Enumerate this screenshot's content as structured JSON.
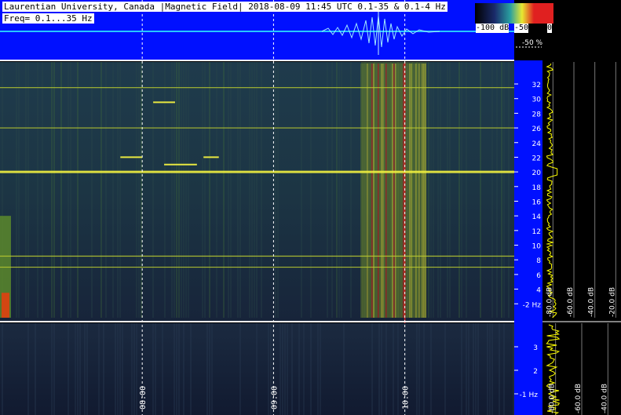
{
  "header": {
    "title": "Laurentian University, Canada |Magnetic Field| 2018-08-09 11:45 UTC 0.1-35 & 0.1-4 Hz",
    "freq_range": "Freq= 0.1...35 Hz"
  },
  "colorbar": {
    "labels": [
      "-100 dB",
      "-50",
      "0"
    ],
    "colors": [
      "#000000",
      "#0a2a90",
      "#2aa0a0",
      "#e8e830",
      "#e02020"
    ]
  },
  "percent_label": "-50 %",
  "chart_data": [
    {
      "type": "heatmap",
      "title": "",
      "ylabel": "Hz",
      "ylim": [
        0.1,
        35
      ],
      "yticks": [
        "-2 Hz",
        "4",
        "6",
        "8",
        "10",
        "12",
        "14",
        "16",
        "18",
        "20",
        "22",
        "24",
        "26",
        "28",
        "30",
        "32"
      ],
      "y_values": [
        2,
        4,
        6,
        8,
        10,
        12,
        14,
        16,
        18,
        20,
        22,
        24,
        26,
        28,
        30,
        32
      ],
      "persistent_lines_hz": [
        7.0,
        8.5,
        20.0,
        26.0,
        31.5
      ],
      "transient_lines": [
        {
          "hz": 22.0,
          "start": "07:50",
          "end": "08:00"
        },
        {
          "hz": 21.0,
          "start": "08:10",
          "end": "08:25"
        },
        {
          "hz": 22.0,
          "start": "08:28",
          "end": "08:35"
        },
        {
          "hz": 29.5,
          "start": "08:05",
          "end": "08:15"
        }
      ],
      "events": [
        {
          "start": "09:40",
          "end": "10:10",
          "peak": "10:00",
          "intensity_db": 0
        },
        {
          "start": "06:55",
          "end": "07:00",
          "intensity_db": -20
        }
      ]
    },
    {
      "type": "heatmap",
      "ylabel": "Hz",
      "ylim": [
        0.1,
        4
      ],
      "yticks": [
        "-1 Hz",
        "2",
        "3"
      ],
      "y_values": [
        1,
        2,
        3
      ]
    },
    {
      "type": "line",
      "title": "",
      "xlabel": "",
      "xticks": [
        "08:00",
        "09:00",
        "10:00"
      ],
      "x_values": [
        "08:00",
        "09:00",
        "10:00"
      ],
      "xlim": [
        "06:55",
        "10:50"
      ]
    },
    {
      "type": "line",
      "xlabel": "dB",
      "xticks": [
        "-80.0 dB",
        "-60.0 dB",
        "-40.0 dB",
        "-20.0 dB"
      ],
      "x_values": [
        -80,
        -60,
        -40,
        -20
      ],
      "xlim": [
        -90,
        -15
      ],
      "ylim": [
        0.1,
        35
      ],
      "peak_hz": 20,
      "peak_db": -76
    },
    {
      "type": "line",
      "xlabel": "dB",
      "xticks": [
        "-80.0 dB",
        "-60.0 dB",
        "-40.0 dB"
      ],
      "x_values": [
        -80,
        -60,
        -40
      ],
      "xlim": [
        -90,
        -30
      ],
      "ylim": [
        0.1,
        4
      ]
    }
  ]
}
